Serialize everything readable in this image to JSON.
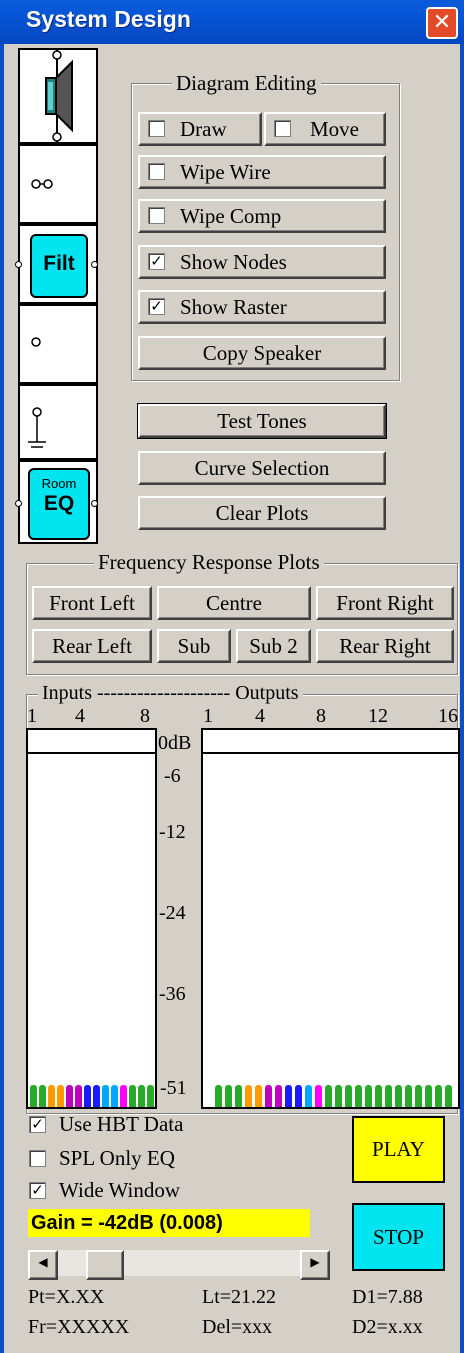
{
  "window": {
    "title": "System Design",
    "close_symbol": "✕"
  },
  "palette": {
    "filt_label": "Filt",
    "room_label": "Room",
    "eq_label": "EQ"
  },
  "diagram_editing": {
    "title": "Diagram Editing",
    "draw": {
      "label": "Draw",
      "checked": false
    },
    "move": {
      "label": "Move",
      "checked": false
    },
    "wipe_wire": {
      "label": "Wipe Wire",
      "checked": false
    },
    "wipe_comp": {
      "label": "Wipe Comp",
      "checked": false
    },
    "show_nodes": {
      "label": "Show Nodes",
      "checked": true
    },
    "show_raster": {
      "label": "Show Raster",
      "checked": true
    },
    "copy_speaker": "Copy Speaker"
  },
  "buttons": {
    "test_tones": "Test Tones",
    "curve_selection": "Curve Selection",
    "clear_plots": "Clear Plots"
  },
  "freq_plots": {
    "title": "Frequency Response Plots",
    "front_left": "Front Left",
    "centre": "Centre",
    "front_right": "Front Right",
    "rear_left": "Rear Left",
    "sub": "Sub",
    "sub2": "Sub 2",
    "rear_right": "Rear Right"
  },
  "meters": {
    "header": "Inputs -------------------- Outputs",
    "input_ticks": [
      "1",
      "4",
      "8"
    ],
    "output_ticks": [
      "1",
      "4",
      "8",
      "12",
      "16"
    ],
    "db_scale": [
      "0dB",
      "-6",
      "-12",
      "-24",
      "-36",
      "-51"
    ],
    "input_bar_colors": [
      "#2aaa2a",
      "#2aaa2a",
      "#ff9a00",
      "#ff9a00",
      "#c000c0",
      "#c000c0",
      "#1a1aff",
      "#1a1aff",
      "#00a8ff",
      "#00a8ff",
      "#ff00ff",
      "#2aaa2a",
      "#2aaa2a",
      "#2aaa2a"
    ],
    "output_bar_colors": [
      "#2aaa2a",
      "#2aaa2a",
      "#2aaa2a",
      "#ff9a00",
      "#ff9a00",
      "#c000c0",
      "#c000c0",
      "#1a1aff",
      "#1a1aff",
      "#00a8ff",
      "#ff00ff",
      "#2aaa2a",
      "#2aaa2a",
      "#2aaa2a",
      "#2aaa2a",
      "#2aaa2a",
      "#2aaa2a",
      "#2aaa2a",
      "#2aaa2a",
      "#2aaa2a",
      "#2aaa2a",
      "#2aaa2a",
      "#2aaa2a",
      "#2aaa2a"
    ]
  },
  "options": {
    "use_hbt": {
      "label": "Use HBT Data",
      "checked": true
    },
    "spl_only": {
      "label": "SPL Only EQ",
      "checked": false
    },
    "wide_window": {
      "label": "Wide Window",
      "checked": true
    }
  },
  "gain": {
    "text": "Gain = -42dB (0.008)",
    "slider_fraction": 0.1
  },
  "play": "PLAY",
  "stop": "STOP",
  "status": {
    "pt": "Pt=X.XX",
    "lt": "Lt=21.22",
    "d1": "D1=7.88",
    "fr": "Fr=XXXXX",
    "del": "Del=xxx",
    "d2": "D2=x.xx"
  },
  "colors": {
    "title_bar": "#0a5ad8",
    "cyan": "#00e5f0",
    "play": "#ffff00",
    "stop": "#00e5f0",
    "gain_highlight": "#ffff00"
  }
}
